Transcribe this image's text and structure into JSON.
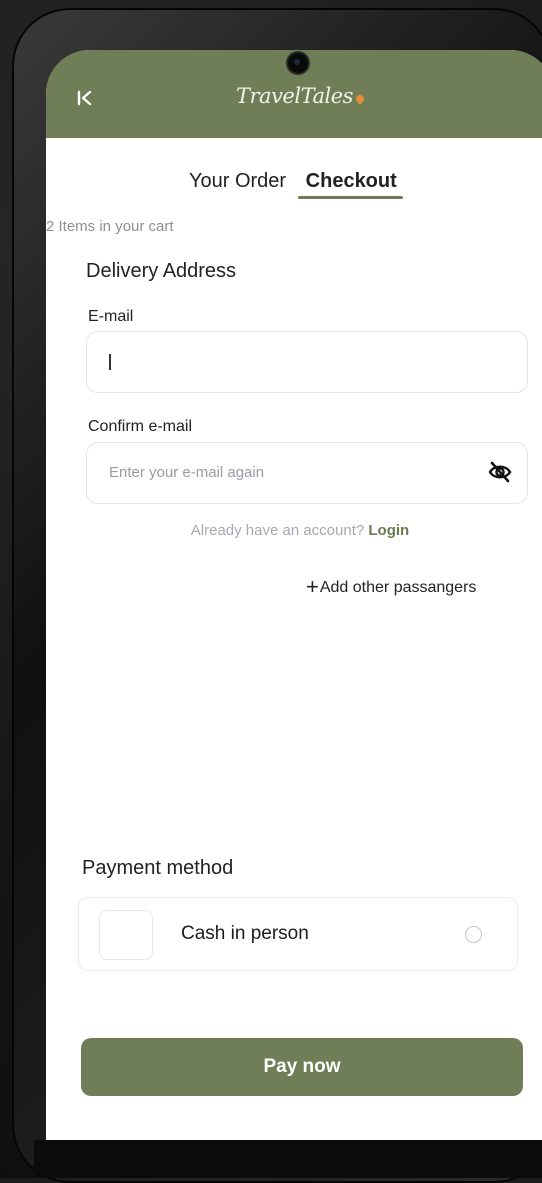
{
  "app": {
    "logo_text": "TravelTales",
    "back_icon": "chevron-back-double-icon",
    "accent_color": "#707e57"
  },
  "tabs": [
    {
      "label": "Your Order",
      "active": false
    },
    {
      "label": "Checkout",
      "active": true
    }
  ],
  "cart": {
    "count_text": "2 Items in your cart"
  },
  "delivery": {
    "title": "Delivery Address",
    "email": {
      "label": "E-mail",
      "value": ""
    },
    "confirm_email": {
      "label": "Confirm e-mail",
      "placeholder": "Enter your e-mail again",
      "icon": "eye-slash-icon"
    },
    "account_prompt": "Already have an account?",
    "login_label": "Login",
    "add_passengers_label": "Add other passangers"
  },
  "payment": {
    "title": "Payment method",
    "options": [
      {
        "label": "Cash in person",
        "selected": false
      }
    ]
  },
  "pay_button_label": "Pay now"
}
